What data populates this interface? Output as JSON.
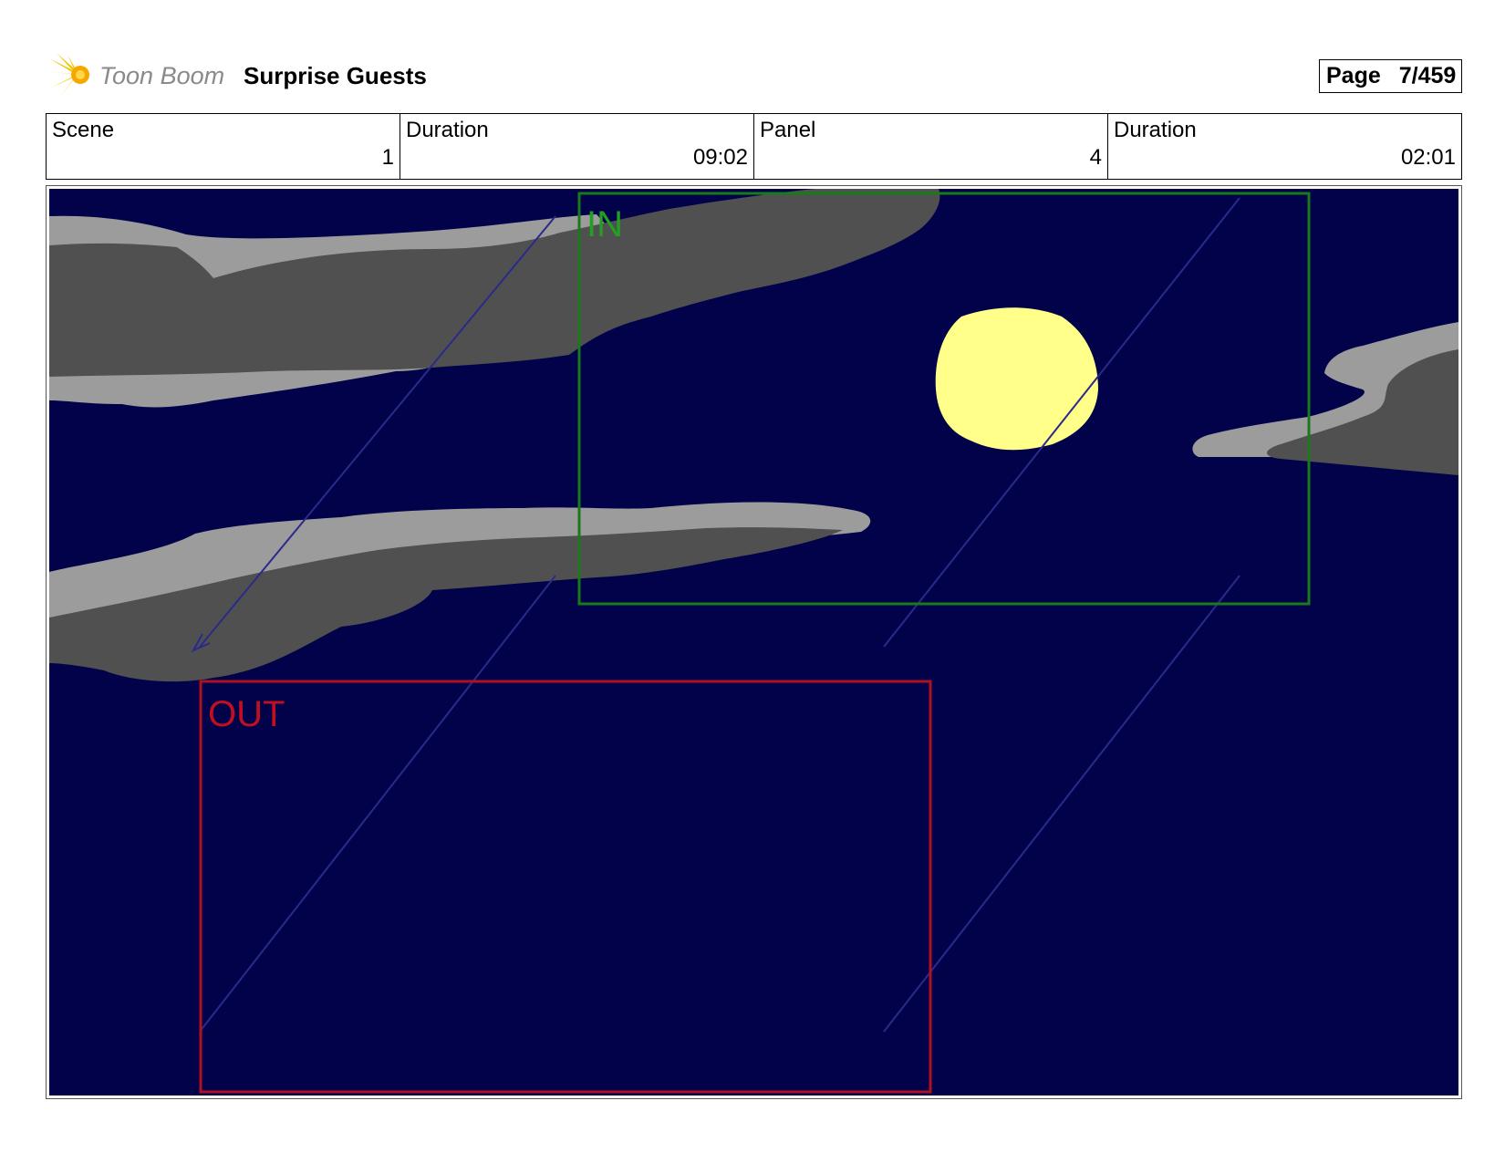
{
  "header": {
    "logo_text": "Toon Boom",
    "title": "Surprise Guests",
    "page_label": "Page",
    "page_value": "7/459"
  },
  "info": {
    "scene_label": "Scene",
    "scene_value": "1",
    "scene_duration_label": "Duration",
    "scene_duration_value": "09:02",
    "panel_label": "Panel",
    "panel_value": "4",
    "panel_duration_label": "Duration",
    "panel_duration_value": "02:01"
  },
  "panel_art": {
    "in_label": "IN",
    "out_label": "OUT",
    "colors": {
      "sky": "#02024a",
      "cloud_dark": "#505050",
      "cloud_light": "#9c9c9c",
      "moon": "#ffff8a",
      "in_frame": "#1a7a1a",
      "out_frame": "#b01020",
      "motion_line": "#2a2a8a"
    }
  }
}
